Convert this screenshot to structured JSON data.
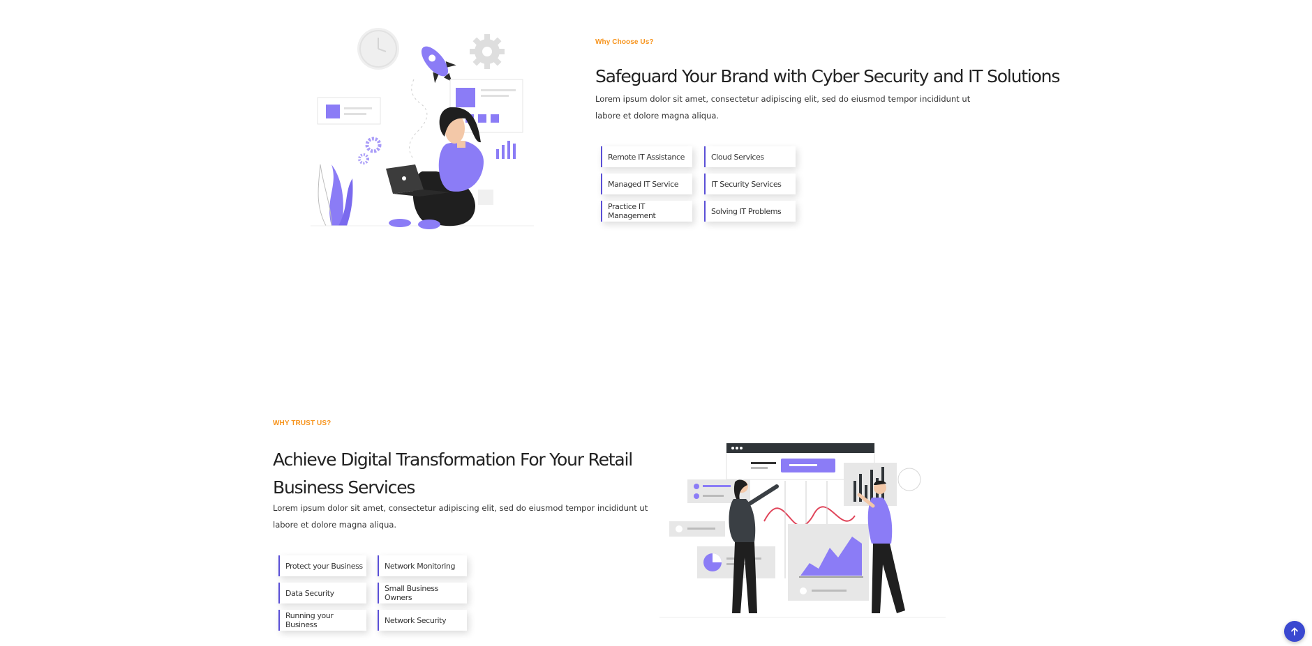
{
  "section1": {
    "eyebrow": "Why Choose Us?",
    "title": "Safeguard Your Brand with Cyber Security and IT Solutions",
    "text": "Lorem ipsum dolor sit amet, consectetur adipiscing elit, sed do eiusmod tempor incididunt ut labore et dolore magna aliqua.",
    "features": [
      "Remote IT Assistance",
      "Cloud Services",
      "Managed IT Service",
      "IT Security Services",
      "Practice IT Management",
      "Solving IT Problems"
    ]
  },
  "section2": {
    "eyebrow": "WHY TRUST US?",
    "title": "Achieve Digital Transformation For Your Retail Business Services",
    "text": "Lorem ipsum dolor sit amet, consectetur adipiscing elit, sed do eiusmod tempor incididunt ut labore et dolore magna aliqua.",
    "features": [
      "Protect your Business",
      "Network Monitoring",
      "Data Security",
      "Small Business Owners",
      "Running your Business",
      "Network Security"
    ]
  },
  "icons": {
    "back_to_top": "arrow-up-icon",
    "illustration1": "woman-laptop-illustration",
    "illustration2": "team-analytics-illustration"
  },
  "colors": {
    "accent": "#f7941d",
    "brand": "#5a4fd6",
    "illustration_purple": "#8b7cf6",
    "back_to_top_bg": "#3a48d0"
  }
}
